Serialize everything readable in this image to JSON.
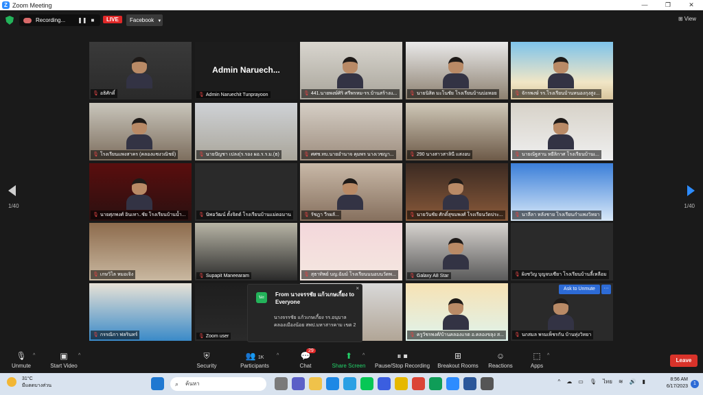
{
  "window": {
    "title": "Zoom Meeting"
  },
  "top": {
    "recording_label": "Recording...",
    "pause_icon": "❚❚",
    "stop_icon": "■",
    "live_label": "LIVE",
    "stream_target": "Facebook",
    "view_label": "View"
  },
  "pagination": {
    "left": "1/40",
    "right": "1/40"
  },
  "tiles": [
    {
      "name": "อธิศักดิ์",
      "active": true
    },
    {
      "name": "Admin Naruechit Tunprayoon",
      "big": "Admin  Naruech..."
    },
    {
      "name": "441.นายพงษ์ศิริ ศรีพรหม-รร.บ้านสร้างแ..."
    },
    {
      "name": "นายนิสิต มะโนชัย โรงเรียนบ้านบ่อหอย"
    },
    {
      "name": "จักรพงษ์ รร.โรงเรียนบ้านหนองกุงสูง..."
    },
    {
      "name": "โรงเรียนแพงสาคร (คลองแซงวณิชย์)"
    },
    {
      "name": "นายปัญชา เปลง(ร.รอง ผอ.ร.ร.ม.(ธ)"
    },
    {
      "name": "ศศช.ทบ.นายอำนาจ คุมพร นางเวชญา..."
    },
    {
      "name": "290 นางสาวสาลินี แสงอบ"
    },
    {
      "name": "นายณัฐสาน หยีลิกาศ โรงเรียนบ้านเ..."
    },
    {
      "name": "นายศุภพงศ์ อินเทา..ชัย โรงเรียนบ้านน้ำ..."
    },
    {
      "name": "นิพอวัฒน์ ตั้งจิตต์ โรงเรียนบ้านแม่ดอมาน"
    },
    {
      "name": "รัชฎา วีรผลั..."
    },
    {
      "name": "นายวันชัย ศักดิ์สุขมพงศ์ โรงเรียนวัดประ..."
    },
    {
      "name": "นาลีลา หลังชาย โรงเรียนกำแพงวิทยา"
    },
    {
      "name": "เกษวิไล หมอเจิง"
    },
    {
      "name": "Supapit Maneearam"
    },
    {
      "name": "สุธาทิพย์ บญ.ฉัมม์ โรงเรียนนนอบนวัดพ..."
    },
    {
      "name": "Galaxy A8 Star"
    },
    {
      "name": "ผิงชวิญ บุญจบเซียา โรงเรียนบ้านลี้เหลือม"
    },
    {
      "name": "กรรณิกา ฟลรินทร์"
    },
    {
      "name": "Zoom user"
    },
    {
      "name": "บ้านหนองคาม"
    },
    {
      "name": "ครูวัชรพงศ์/บ้านคลองแรต อ.คลองขลุง ส..."
    },
    {
      "name": "นกสมล พรมเพ็ชรกัน บ้านทุ่งวิทยา"
    }
  ],
  "chat_popup": {
    "avatar_text": "นะ",
    "from": "From นางจรรชัย แก้วเกษเกี้ยง to Everyone",
    "message": "นางจรรชัย  แก้วเกษเกี้ยง รร.อนุบาลคลองเมืองน้อย สพป.มหาสารคาม เขต 2",
    "close": "×"
  },
  "ask_unmute": "Ask to Unmute",
  "more": "···",
  "toolbar": {
    "unmute": "Unmute",
    "start_video": "Start Video",
    "security": "Security",
    "participants": "Participants",
    "participants_count": "1K",
    "chat": "Chat",
    "chat_badge": "29",
    "share_screen": "Share Screen",
    "pause_recording": "Pause/Stop Recording",
    "breakout_rooms": "Breakout Rooms",
    "reactions": "Reactions",
    "apps": "Apps",
    "leave": "Leave"
  },
  "taskbar": {
    "temperature": "31°C",
    "weather_text": "มีแดดบางส่วน",
    "search_placeholder": "ค้นหา",
    "lang": "ไทย",
    "time": "8:56 AM",
    "date": "6/17/2023",
    "notif_count": "1"
  },
  "colors": {
    "active_outline": "#d6e04a",
    "live_red": "#e02828",
    "share_green": "#23d36a",
    "leave_red": "#d9332a",
    "zoom_blue": "#2d8cff"
  }
}
